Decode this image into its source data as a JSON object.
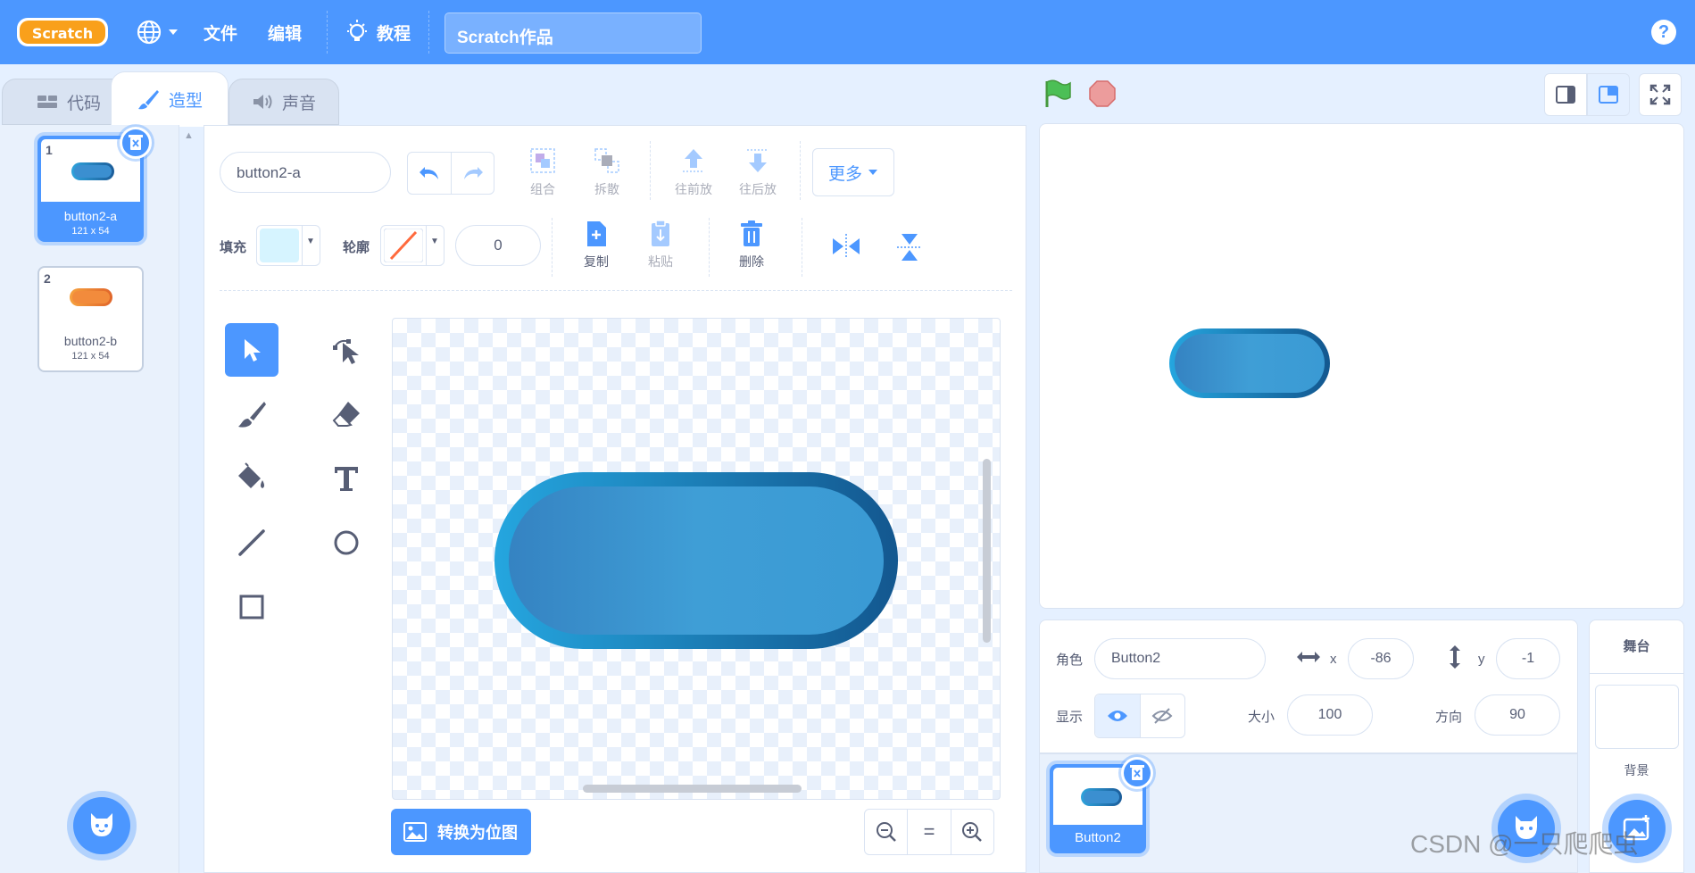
{
  "menubar": {
    "logo_text": "Scratch",
    "file_label": "文件",
    "edit_label": "编辑",
    "tutorials_label": "教程",
    "project_title": "Scratch作品",
    "help_label": "?"
  },
  "tabs": [
    {
      "label": "代码",
      "active": false
    },
    {
      "label": "造型",
      "active": true
    },
    {
      "label": "声音",
      "active": false
    }
  ],
  "costumes": [
    {
      "num": "1",
      "name": "button2-a",
      "size": "121 x 54",
      "selected": true,
      "color": "#3b8fd0"
    },
    {
      "num": "2",
      "name": "button2-b",
      "size": "121 x 54",
      "selected": false,
      "color": "#f28b3c"
    }
  ],
  "editor": {
    "costume_name": "button2-a",
    "group_label": "组合",
    "ungroup_label": "拆散",
    "forward_label": "往前放",
    "backward_label": "往后放",
    "more_label": "更多",
    "fill_label": "填充",
    "fill_color": "#d6f4ff",
    "outline_label": "轮廓",
    "outline_width": "0",
    "copy_label": "复制",
    "paste_label": "粘贴",
    "delete_label": "删除",
    "convert_label": "转换为位图",
    "zoom_reset_label": "="
  },
  "sprite_info": {
    "sprite_label": "角色",
    "sprite_name": "Button2",
    "x_label": "x",
    "x_value": "-86",
    "y_label": "y",
    "y_value": "-1",
    "show_label": "显示",
    "size_label": "大小",
    "size_value": "100",
    "direction_label": "方向",
    "direction_value": "90"
  },
  "sprites": [
    {
      "name": "Button2",
      "selected": true
    }
  ],
  "stage_pane": {
    "title": "舞台",
    "backdrops_label": "背景"
  },
  "watermark": "CSDN @一只爬爬虫",
  "colors": {
    "menubar": "#4c97ff",
    "accent": "#4c97ff",
    "button_dark": "#1b5c99",
    "button_light": "#3f9ed6",
    "go_flag": "#4cbf56",
    "stop": "#ec9c9c"
  }
}
